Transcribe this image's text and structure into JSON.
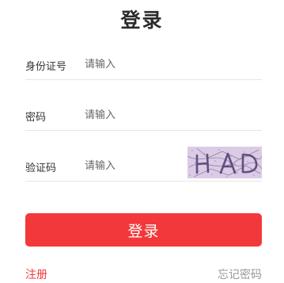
{
  "header": {
    "title": "登录"
  },
  "form": {
    "id_number": {
      "label": "身份证号",
      "placeholder": "请输入",
      "value": ""
    },
    "password": {
      "label": "密码",
      "placeholder": "请输入",
      "value": ""
    },
    "captcha": {
      "label": "验证码",
      "placeholder": "请输入",
      "value": "",
      "image_text": "HAD"
    }
  },
  "actions": {
    "login_label": "登录",
    "register_label": "注册",
    "forgot_label": "忘记密码"
  },
  "colors": {
    "accent": "#f2383a",
    "captcha_background": "#d9c9e3"
  }
}
